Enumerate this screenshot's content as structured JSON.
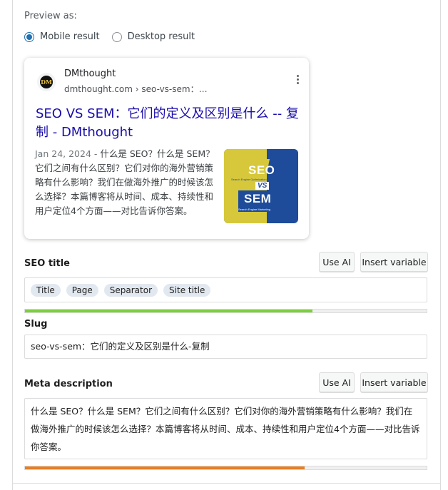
{
  "preview": {
    "label": "Preview as:",
    "options": [
      "Mobile result",
      "Desktop result"
    ],
    "selected": "Mobile result"
  },
  "serp": {
    "site_name": "DMthought",
    "site_url": "dmthought.com › seo-vs-sem：…",
    "title": "SEO VS SEM：它们的定义及区别是什么 -- 复制 - DMthought",
    "date": "Jan 24, 2024",
    "separator": " - ",
    "description": "什么是 SEO？什么是 SEM？它们之间有什么区别？它们对你的海外营销策略有什么影响？我们在做海外推广的时候该怎么选择？本篇博客将从时间、成本、持续性和用户定位4个方面——对比告诉你答案。",
    "thumb": {
      "line1": "SEO",
      "vs": "VS",
      "line2": "SEM",
      "small_top": "Search Engine Optimization",
      "small_bottom": "Search Engine Marketing"
    },
    "favicon_text": "DM"
  },
  "seo_title": {
    "label": "SEO title",
    "use_ai": "Use AI",
    "insert_variable": "Insert variable",
    "chips": [
      "Title",
      "Page",
      "Separator",
      "Site title"
    ],
    "progress": 0.715,
    "progress_color": "#7ad03a"
  },
  "slug": {
    "label": "Slug",
    "value": "seo-vs-sem：它们的定义及区别是什么-复制"
  },
  "meta_description": {
    "label": "Meta description",
    "use_ai": "Use AI",
    "insert_variable": "Insert variable",
    "value": "什么是 SEO？什么是 SEM？它们之间有什么区别？它们对你的海外营销策略有什么影响？我们在做海外推广的时候该怎么选择？本篇博客将从时间、成本、持续性和用户定位4个方面——对比告诉你答案。",
    "progress": 0.697,
    "progress_color": "#e67e22"
  },
  "colors": {
    "link": "#1a0dab",
    "radio": "#2271b1",
    "thumb_blue": "#1e4b9a",
    "thumb_yellow": "#d6c83a"
  }
}
